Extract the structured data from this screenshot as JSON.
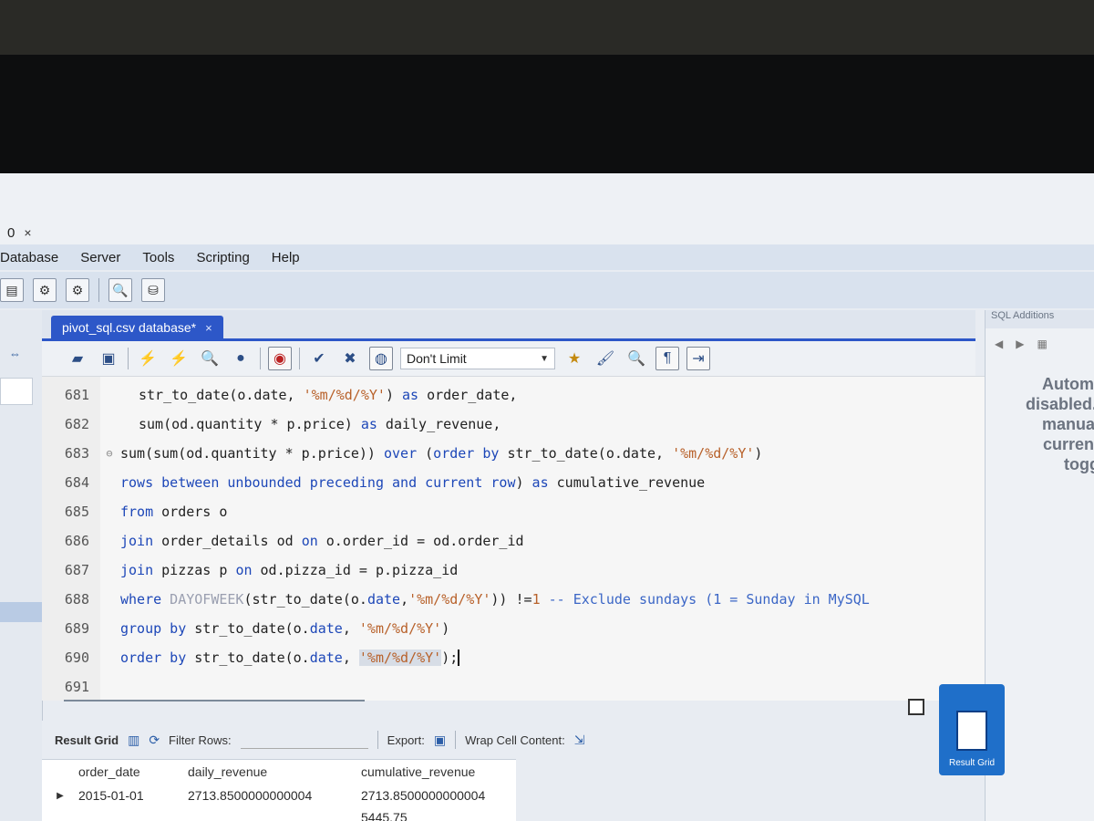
{
  "window": {
    "connection_tab": "0",
    "close_glyph": "×"
  },
  "menubar": {
    "items": [
      "Database",
      "Server",
      "Tools",
      "Scripting",
      "Help"
    ]
  },
  "editor_tab": {
    "label": "pivot_sql.csv database*",
    "close_glyph": "×"
  },
  "sql_toolbar": {
    "limit_select": "Don't Limit"
  },
  "editor": {
    "lines": [
      {
        "num": "681"
      },
      {
        "num": "682"
      },
      {
        "num": "683"
      },
      {
        "num": "684"
      },
      {
        "num": "685"
      },
      {
        "num": "686"
      },
      {
        "num": "687"
      },
      {
        "num": "688"
      },
      {
        "num": "689"
      },
      {
        "num": "690"
      },
      {
        "num": "691"
      }
    ],
    "code": {
      "l681_a": "str_to_date(o.date, ",
      "l681_s": "'%m/%d/%Y'",
      "l681_b": ") ",
      "l681_k": "as",
      "l681_c": " order_date,",
      "l682_a": "sum(od.quantity * p.price) ",
      "l682_k": "as",
      "l682_b": " daily_revenue,",
      "l683_a": "sum(sum(od.quantity * p.price)) ",
      "l683_k1": "over",
      "l683_b": " (",
      "l683_k2": "order by",
      "l683_c": " str_to_date(o.date, ",
      "l683_s": "'%m/%d/%Y'",
      "l683_d": ")",
      "l684_k1": "rows between unbounded preceding and current row",
      "l684_b": ") ",
      "l684_k2": "as",
      "l684_c": " cumulative_revenue",
      "l685_k": "from",
      "l685_b": " orders o",
      "l686_k1": "join",
      "l686_b": " order_details od ",
      "l686_k2": "on",
      "l686_c": " o.order_id = od.order_id",
      "l687_k1": "join",
      "l687_b": " pizzas p ",
      "l687_k2": "on",
      "l687_c": " od.pizza_id = p.pizza_id",
      "l688_k": "where",
      "l688_fn": " DAYOFWEEK",
      "l688_b": "(str_to_date(o.",
      "l688_k2": "date",
      "l688_c": ",",
      "l688_s": "'%m/%d/%Y'",
      "l688_d": ")) !=",
      "l688_n": "1",
      "l688_cm": " -- Exclude sundays (1 = Sunday in MySQL",
      "l689_k": "group by",
      "l689_b": " str_to_date(o.",
      "l689_k2": "date",
      "l689_c": ", ",
      "l689_s": "'%m/%d/%Y'",
      "l689_d": ")",
      "l690_k": "order by",
      "l690_b": " str_to_date(o.",
      "l690_k2": "date",
      "l690_c": ", ",
      "l690_s": "'%m/%d/%Y'",
      "l690_d": ");"
    }
  },
  "right_panel": {
    "header": "SQL Additions",
    "message_lines": [
      "Automati",
      "disabled. U",
      "manually",
      "current c",
      "toggle"
    ]
  },
  "result_toolbar": {
    "result_grid_label": "Result Grid",
    "filter_label": "Filter Rows:",
    "export_label": "Export:",
    "wrap_label": "Wrap Cell Content:"
  },
  "result_grid": {
    "columns": [
      "order_date",
      "daily_revenue",
      "cumulative_revenue"
    ],
    "rows": [
      [
        "2015-01-01",
        "2713.8500000000004",
        "2713.8500000000004"
      ],
      [
        "",
        "",
        "5445.75"
      ]
    ]
  },
  "result_side": {
    "button_label": "Result Grid"
  },
  "colors": {
    "accent": "#2d57c8",
    "keyword": "#1d47b8",
    "string": "#b8612a"
  }
}
